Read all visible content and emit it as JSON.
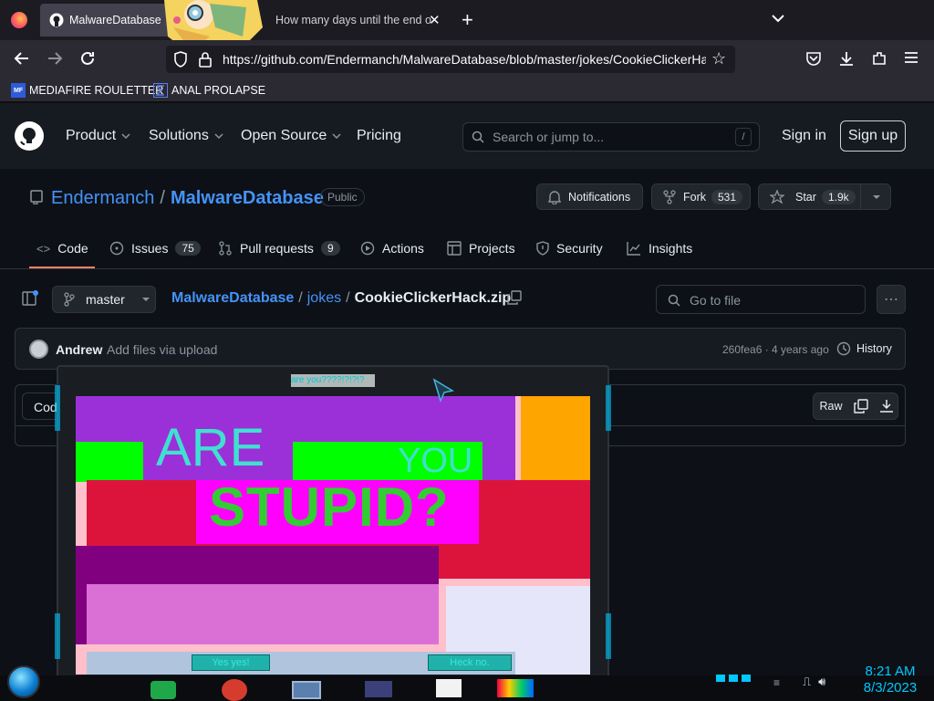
{
  "browser": {
    "tabs": [
      {
        "title": "MalwareDatabase"
      },
      {
        "title": "How many days until the end o"
      }
    ],
    "url": "https://github.com/Endermanch/MalwareDatabase/blob/master/jokes/CookieClickerHa",
    "bookmarks": [
      {
        "label": "MEDIAFIRE ROULETTER",
        "icon": "MF"
      },
      {
        "label": "ANAL PROLAPSE"
      }
    ]
  },
  "github": {
    "nav": [
      "Product",
      "Solutions",
      "Open Source",
      "Pricing"
    ],
    "search_placeholder": "Search or jump to...",
    "search_key": "/",
    "sign_in": "Sign in",
    "sign_up": "Sign up"
  },
  "repo": {
    "owner": "Endermanch",
    "separator": "/",
    "name": "MalwareDatabase",
    "visibility": "Public",
    "notifications": "Notifications",
    "fork_label": "Fork",
    "fork_count": "531",
    "star_label": "Star",
    "star_count": "1.9k",
    "tabs": [
      {
        "label": "Code",
        "count": ""
      },
      {
        "label": "Issues",
        "count": "75"
      },
      {
        "label": "Pull requests",
        "count": "9"
      },
      {
        "label": "Actions",
        "count": ""
      },
      {
        "label": "Projects",
        "count": ""
      },
      {
        "label": "Security",
        "count": ""
      },
      {
        "label": "Insights",
        "count": ""
      }
    ]
  },
  "file": {
    "branch": "master",
    "path_repo": "MalwareDatabase",
    "path_dir": "jokes",
    "path_file": "CookieClickerHack.zip",
    "goto_placeholder": "Go to file",
    "commit_author": "Andrew",
    "commit_message": "Add files via upload",
    "commit_meta": "260fea6 · 4 years ago",
    "history": "History",
    "code_tab": "Code",
    "raw": "Raw"
  },
  "popup": {
    "title": "are you????!?!?!?",
    "word1": "ARE",
    "word2": "YOU",
    "word3": "STUPID?",
    "yes": "Yes yes!",
    "no": "Heck no."
  },
  "taskbar": {
    "time": "8:21 AM",
    "date": "8/3/2023"
  },
  "colors": {
    "bg": "#0d1117",
    "link": "#4493f8",
    "purple": "#9b30d8",
    "lime": "#00ff00",
    "crimson": "#dc143c",
    "magenta": "#ff00ff",
    "orange": "#ffa500",
    "cyan_text": "#40e0d0"
  }
}
